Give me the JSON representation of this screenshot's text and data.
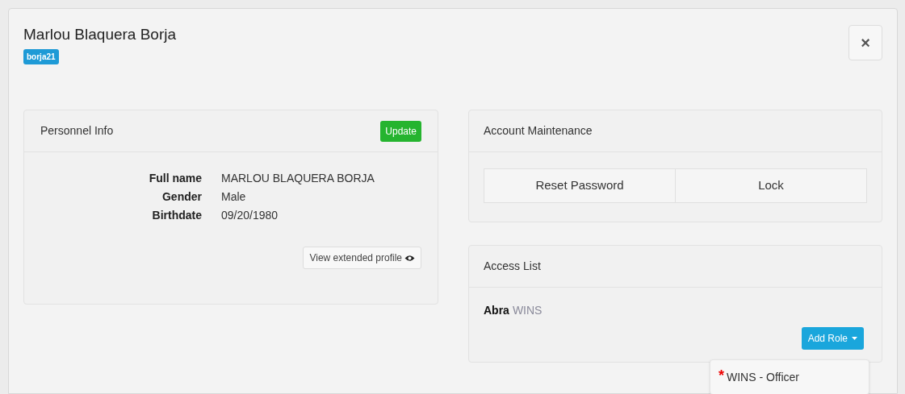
{
  "modal": {
    "title": "Marlou Blaquera Borja",
    "username_badge": "borja21",
    "close": "×"
  },
  "personnel_info": {
    "heading": "Personnel Info",
    "update_button": "Update",
    "fields": [
      {
        "label": "Full name",
        "value": "MARLOU BLAQUERA BORJA"
      },
      {
        "label": "Gender",
        "value": "Male"
      },
      {
        "label": "Birthdate",
        "value": "09/20/1980"
      }
    ],
    "extended_profile_button": "View extended profile"
  },
  "account_maintenance": {
    "heading": "Account Maintenance",
    "buttons": [
      "Reset Password",
      "Lock"
    ]
  },
  "access_list": {
    "heading": "Access List",
    "entries": [
      {
        "organization": "Abra",
        "system": "WINS"
      }
    ],
    "add_role_button": "Add Role",
    "dropdown_open": true,
    "dropdown_items": [
      {
        "required_mark": "*",
        "label": "WINS - Officer"
      }
    ]
  }
}
